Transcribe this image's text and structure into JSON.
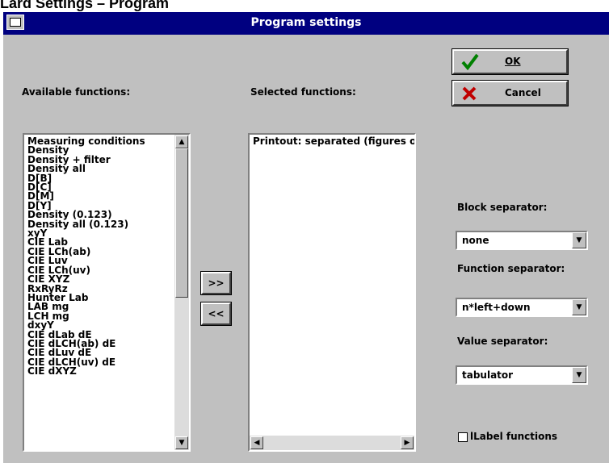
{
  "page_heading": "Lard Settings – Program",
  "window": {
    "title": "Program settings"
  },
  "labels": {
    "available": "Available functions:",
    "selected": "Selected functions:",
    "block_separator": "Block separator:",
    "function_separator": "Function separator:",
    "value_separator": "Value separator:"
  },
  "buttons": {
    "ok": "OK",
    "cancel": "Cancel",
    "add": ">>",
    "remove": "<<"
  },
  "available_functions": [
    "Measuring conditions",
    "Density",
    "Density + filter",
    "Density all",
    "D[B]",
    "D[C]",
    "D[M]",
    "D[Y]",
    "Density (0.123)",
    "Density all (0.123)",
    "xyY",
    "CIE Lab",
    "CIE LCh(ab)",
    "CIE Luv",
    "CIE LCh(uv)",
    "CIE XYZ",
    "RxRyRz",
    "Hunter Lab",
    "LAB mg",
    "LCH mg",
    "dxyY",
    "CIE dLab dE",
    "CIE dLCH(ab) dE",
    "CIE dLuv dE",
    "CIE dLCH(uv) dE",
    "CIE dXYZ"
  ],
  "selected_functions": [
    "Printout: separated (figures on"
  ],
  "combos": {
    "block_separator": "none",
    "function_separator": "n*left+down",
    "value_separator": "tabulator"
  },
  "checkbox": {
    "label": "lLabel functions",
    "checked": false
  }
}
